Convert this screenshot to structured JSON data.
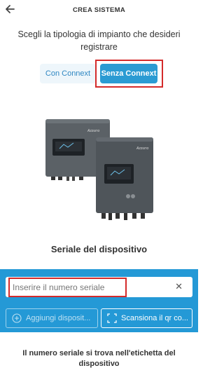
{
  "header": {
    "title": "CREA SISTEMA",
    "back_icon": "arrow-left-icon"
  },
  "prompt": "Scegli la tipologia di impianto che desideri registrare",
  "mode": {
    "options": [
      {
        "label": "Con Connext",
        "selected": false
      },
      {
        "label": "Senza Connext",
        "selected": true
      }
    ]
  },
  "device": {
    "brand": "Azzurro"
  },
  "serial": {
    "section_title": "Seriale del dispositivo",
    "placeholder": "Inserire il numero seriale",
    "value": "",
    "clear_icon": "close-icon",
    "add_label": "Aggiungi disposit...",
    "scan_label": "Scansiona il qr co..."
  },
  "footnote": "Il numero seriale si trova nell'etichetta del dispositivo",
  "colors": {
    "accent": "#2b9bd3",
    "panel": "#2499d6",
    "highlight": "#d42b2b",
    "inverter": "#545a5f"
  }
}
